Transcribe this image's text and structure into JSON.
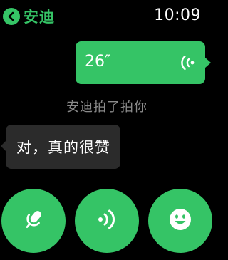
{
  "header": {
    "back_icon": "chevron-left-icon",
    "title": "安迪",
    "time": "10:09"
  },
  "messages": {
    "voice": {
      "duration": "26″",
      "icon": "voice-wave-icon"
    },
    "system_notice": "安迪拍了拍你",
    "incoming_text": "对，真的很赞"
  },
  "actions": [
    {
      "name": "microphone",
      "icon": "microphone-icon"
    },
    {
      "name": "voice-wave",
      "icon": "voice-wave-icon"
    },
    {
      "name": "emoji",
      "icon": "smiley-icon"
    }
  ],
  "colors": {
    "accent": "#35c466",
    "background": "#000000",
    "incoming_bubble": "#2b2b2b",
    "muted_text": "#8a8a8a"
  }
}
